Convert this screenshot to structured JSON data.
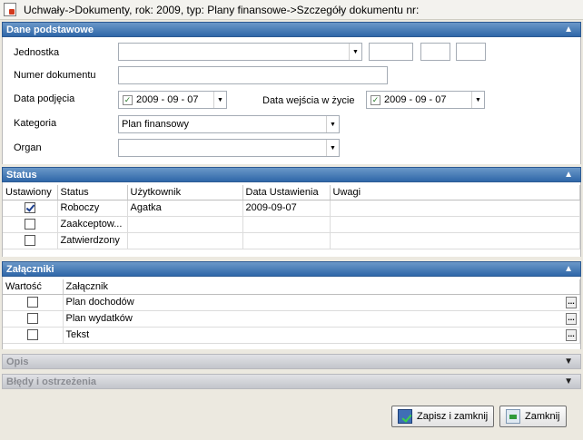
{
  "window": {
    "title": "Uchwały->Dokumenty, rok: 2009, typ: Plany finansowe->Szczegóły dokumentu nr:"
  },
  "dane": {
    "header": "Dane podstawowe",
    "jednostka_label": "Jednostka",
    "jednostka_value": "",
    "numer_label": "Numer dokumentu",
    "numer_value": "",
    "data_podjecia_label": "Data podjęcia",
    "data_podjecia_value": "2009 - 09 - 07",
    "data_wejscia_label": "Data wejścia w życie",
    "data_wejscia_value": "2009 - 09 - 07",
    "kategoria_label": "Kategoria",
    "kategoria_value": "Plan finansowy",
    "organ_label": "Organ",
    "organ_value": ""
  },
  "status": {
    "header": "Status",
    "columns": [
      "Ustawiony",
      "Status",
      "Użytkownik",
      "Data Ustawienia",
      "Uwagi"
    ],
    "rows": [
      {
        "checked": true,
        "status": "Roboczy",
        "user": "Agatka",
        "date": "2009-09-07",
        "note": ""
      },
      {
        "checked": false,
        "status": "Zaakceptow...",
        "user": "",
        "date": "",
        "note": ""
      },
      {
        "checked": false,
        "status": "Zatwierdzony",
        "user": "",
        "date": "",
        "note": ""
      }
    ]
  },
  "zalaczniki": {
    "header": "Załączniki",
    "columns": [
      "Wartość",
      "Załącznik"
    ],
    "rows": [
      {
        "checked": false,
        "name": "Plan dochodów"
      },
      {
        "checked": false,
        "name": "Plan wydatków"
      },
      {
        "checked": false,
        "name": "Tekst"
      }
    ],
    "ellipsis": "..."
  },
  "opis": {
    "header": "Opis"
  },
  "bledy": {
    "header": "Błędy i ostrzeżenia"
  },
  "buttons": {
    "save_close": "Zapisz i zamknij",
    "close": "Zamknij"
  },
  "icons": {
    "collapse": "double-chevron-up-icon",
    "expand": "double-chevron-down-icon",
    "dropdown": "dropdown-arrow-icon"
  }
}
